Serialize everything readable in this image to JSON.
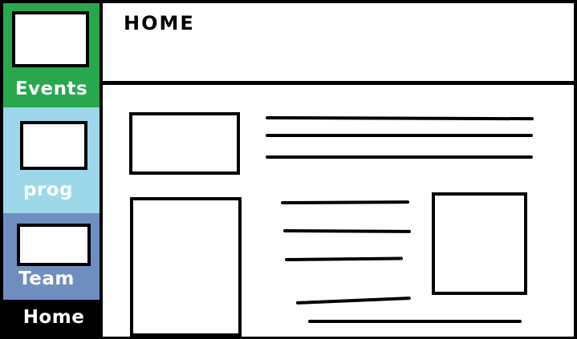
{
  "header": {
    "title": "HOME"
  },
  "sidebar": {
    "items": [
      {
        "label": "Events",
        "color": "#27a84d"
      },
      {
        "label": "prog",
        "color": "#9cd8ea"
      },
      {
        "label": "Team",
        "color": "#6e8fbf"
      },
      {
        "label": "Home",
        "color": "#000000"
      }
    ]
  },
  "colors": {
    "border": "#000000",
    "background": "#ffffff"
  }
}
